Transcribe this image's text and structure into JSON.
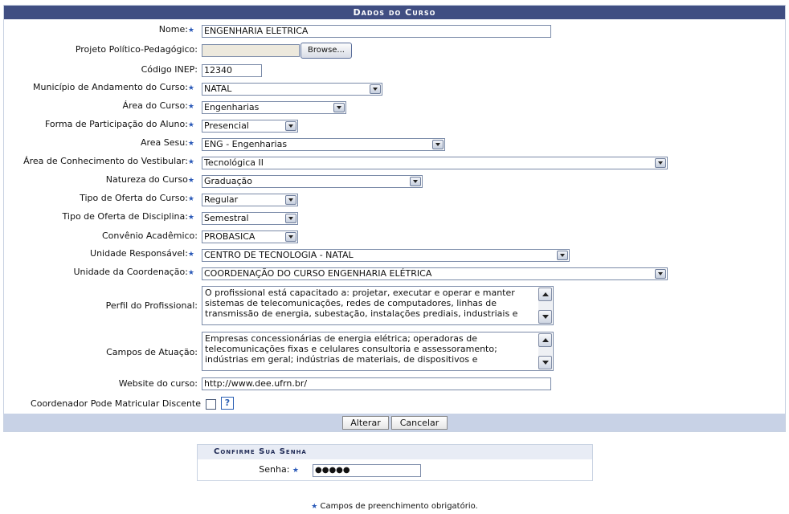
{
  "panel": {
    "title": "Dados do Curso"
  },
  "required_marker": "★",
  "fields": {
    "nome": {
      "label": "Nome:",
      "value": "ENGENHARIA ELETRICA"
    },
    "projeto": {
      "label": "Projeto Político-Pedagógico:",
      "button": "Browse..."
    },
    "inep": {
      "label": "Código INEP:",
      "value": "12340"
    },
    "municipio": {
      "label": "Município de Andamento do Curso:",
      "value": "NATAL"
    },
    "area": {
      "label": "Área do Curso:",
      "value": "Engenharias"
    },
    "participacao": {
      "label": "Forma de Participação do Aluno:",
      "value": "Presencial"
    },
    "sesu": {
      "label": "Area Sesu:",
      "value": "ENG - Engenharias"
    },
    "vestibular": {
      "label": "Área de Conhecimento do Vestibular:",
      "value": "Tecnológica II"
    },
    "natureza": {
      "label": "Natureza do Curso",
      "value": "Graduação"
    },
    "oferta_curso": {
      "label": "Tipo de Oferta do Curso:",
      "value": "Regular"
    },
    "oferta_disciplina": {
      "label": "Tipo de Oferta de Disciplina:",
      "value": "Semestral"
    },
    "convenio": {
      "label": "Convênio Acadêmico:",
      "value": "PROBASICA"
    },
    "unidade_resp": {
      "label": "Unidade Responsável:",
      "value": "CENTRO DE TECNOLOGIA - NATAL"
    },
    "unidade_coord": {
      "label": "Unidade da Coordenação:",
      "value": "COORDENAÇÃO DO CURSO ENGENHARIA ELÉTRICA"
    },
    "perfil": {
      "label": "Perfil do Profissional:",
      "value": "O profissional está capacitado a: projetar, executar e operar e manter sistemas de telecomunicações, redes de computadores, linhas de transmissão de energia, subestação, instalações prediais, industriais e"
    },
    "campos": {
      "label": "Campos de Atuação:",
      "value": "Empresas concessionárias de energia elétrica; operadoras de telecomunicações fixas e celulares consultoria e assessoramento; indústrias em geral; indústrias de materiais, de dispositivos e"
    },
    "website": {
      "label": "Website do curso:",
      "value": "http://www.dee.ufrn.br/"
    },
    "coordenador": {
      "label": "Coordenador Pode Matricular Discente",
      "help": "?"
    }
  },
  "buttons": {
    "alterar": "Alterar",
    "cancelar": "Cancelar"
  },
  "confirm": {
    "title": "Confirme Sua Senha",
    "label": "Senha:",
    "value": "●●●●●"
  },
  "note": "Campos de preenchimento obrigatório."
}
